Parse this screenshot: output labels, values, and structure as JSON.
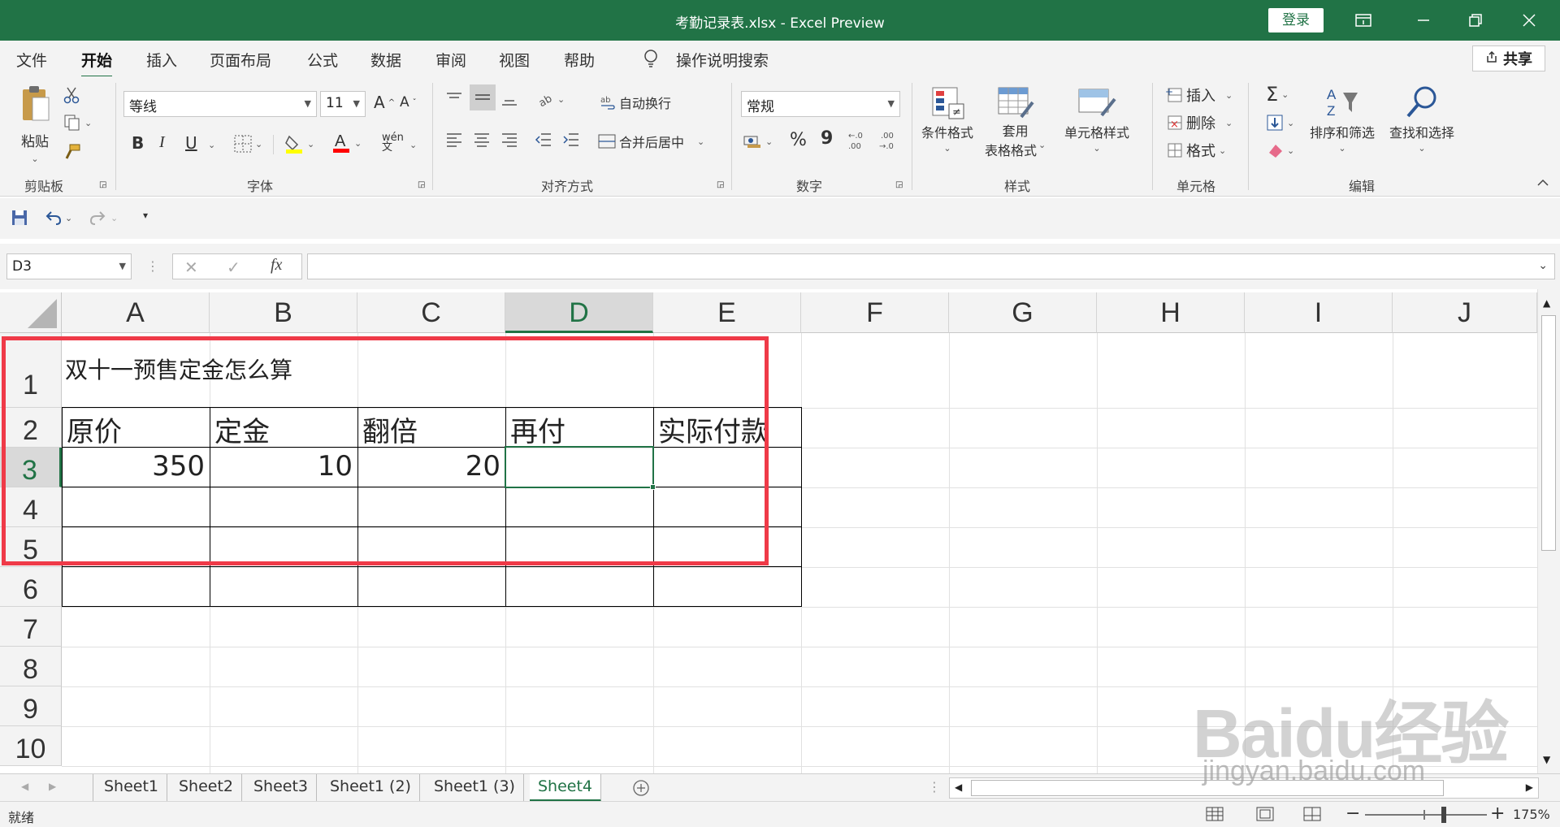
{
  "window": {
    "title": "考勤记录表.xlsx - Excel Preview",
    "login": "登录"
  },
  "menu": {
    "tabs": [
      "文件",
      "开始",
      "插入",
      "页面布局",
      "公式",
      "数据",
      "审阅",
      "视图",
      "帮助"
    ],
    "active_tab": "开始",
    "tell_me": "操作说明搜索",
    "share": "共享"
  },
  "ribbon": {
    "clipboard": {
      "paste": "粘贴",
      "label": "剪贴板"
    },
    "font": {
      "name": "等线",
      "size": "11",
      "bold": "B",
      "italic": "I",
      "underline": "U",
      "label": "字体",
      "highlight_color": "#ffff00",
      "font_color": "#ff0000"
    },
    "alignment": {
      "wrap": "自动换行",
      "merge": "合并后居中",
      "label": "对齐方式"
    },
    "number": {
      "format": "常规",
      "percent": "%",
      "comma": "9",
      "label": "数字"
    },
    "styles": {
      "conditional": "条件格式",
      "table1": "套用",
      "table2": "表格格式",
      "cell_styles": "单元格样式",
      "label": "样式"
    },
    "cells": {
      "insert": "插入",
      "delete": "删除",
      "format": "格式",
      "label": "单元格"
    },
    "editing": {
      "sort": "排序和筛选",
      "find": "查找和选择",
      "label": "编辑"
    }
  },
  "formula_bar": {
    "name_box": "D3",
    "value": ""
  },
  "columns": [
    "A",
    "B",
    "C",
    "D",
    "E",
    "F",
    "G",
    "H",
    "I",
    "J"
  ],
  "rows": [
    "1",
    "2",
    "3",
    "4",
    "5",
    "6",
    "7",
    "8",
    "9",
    "10"
  ],
  "cells": {
    "A1": "双十一预售定金怎么算",
    "A2": "原价",
    "B2": "定金",
    "C2": "翻倍",
    "D2": "再付",
    "E2": "实际付款",
    "A3": "350",
    "B3": "10",
    "C3": "20"
  },
  "sheets": [
    "Sheet1",
    "Sheet2",
    "Sheet3",
    "Sheet1 (2)",
    "Sheet1 (3)",
    "Sheet4"
  ],
  "active_sheet": "Sheet4",
  "status": {
    "ready": "就绪",
    "zoom": "175%"
  },
  "watermark": {
    "brand": "Baidu经验",
    "url": "jingyan.baidu.com"
  },
  "colors": {
    "accent": "#217346",
    "highlight_box": "#ef3a48"
  }
}
